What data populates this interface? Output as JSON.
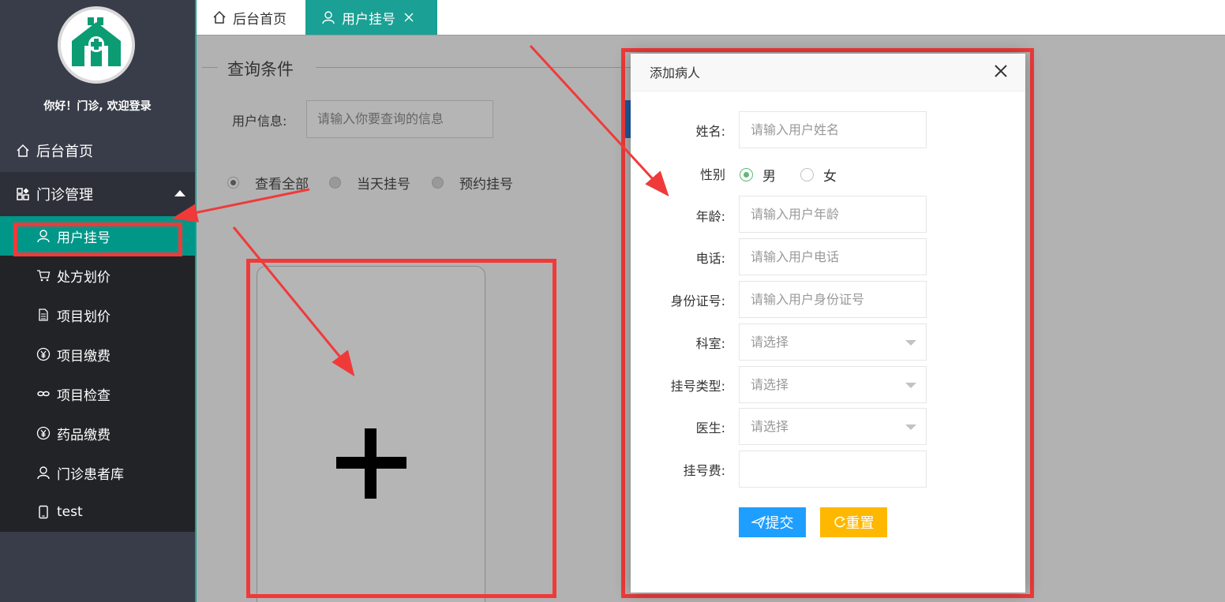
{
  "sidebar": {
    "welcome": "你好！门诊, 欢迎登录",
    "home_label": "后台首页",
    "group_label": "门诊管理",
    "items": [
      {
        "label": "用户挂号",
        "icon": "user-icon"
      },
      {
        "label": "处方划价",
        "icon": "cart-icon"
      },
      {
        "label": "项目划价",
        "icon": "document-icon"
      },
      {
        "label": "项目缴费",
        "icon": "yen-icon"
      },
      {
        "label": "项目检查",
        "icon": "link-icon"
      },
      {
        "label": "药品缴费",
        "icon": "yen-icon"
      },
      {
        "label": "门诊患者库",
        "icon": "person-icon"
      },
      {
        "label": "test",
        "icon": "phone-icon"
      }
    ]
  },
  "tabs": [
    {
      "label": "后台首页",
      "icon": "home-icon"
    },
    {
      "label": "用户挂号",
      "icon": "user-icon",
      "closable": true
    }
  ],
  "query": {
    "legend": "查询条件",
    "user_info_label": "用户信息:",
    "user_info_placeholder": "请输入你要查询的信息",
    "filters": [
      "查看全部",
      "当天挂号",
      "预约挂号"
    ],
    "selected_filter": "查看全部"
  },
  "modal": {
    "title": "添加病人",
    "fields": {
      "name_label": "姓名:",
      "name_placeholder": "请输入用户姓名",
      "gender_label": "性别",
      "gender_male": "男",
      "gender_female": "女",
      "age_label": "年龄:",
      "age_placeholder": "请输入用户年龄",
      "phone_label": "电话:",
      "phone_placeholder": "请输入用户电话",
      "id_label": "身份证号:",
      "id_placeholder": "请输入用户身份证号",
      "dept_label": "科室:",
      "dept_value": "请选择",
      "reg_type_label": "挂号类型:",
      "reg_type_value": "请选择",
      "doctor_label": "医生:",
      "doctor_value": "请选择",
      "fee_label": "挂号费:",
      "fee_value": ""
    },
    "submit_label": "提交",
    "reset_label": "重置"
  },
  "colors": {
    "sidebar_bg": "#393d49",
    "active_teal": "#009688",
    "tab_active": "#1aa094",
    "annotation_red": "#f03a3a",
    "submit_blue": "#1e9fff",
    "reset_yellow": "#ffb800"
  }
}
